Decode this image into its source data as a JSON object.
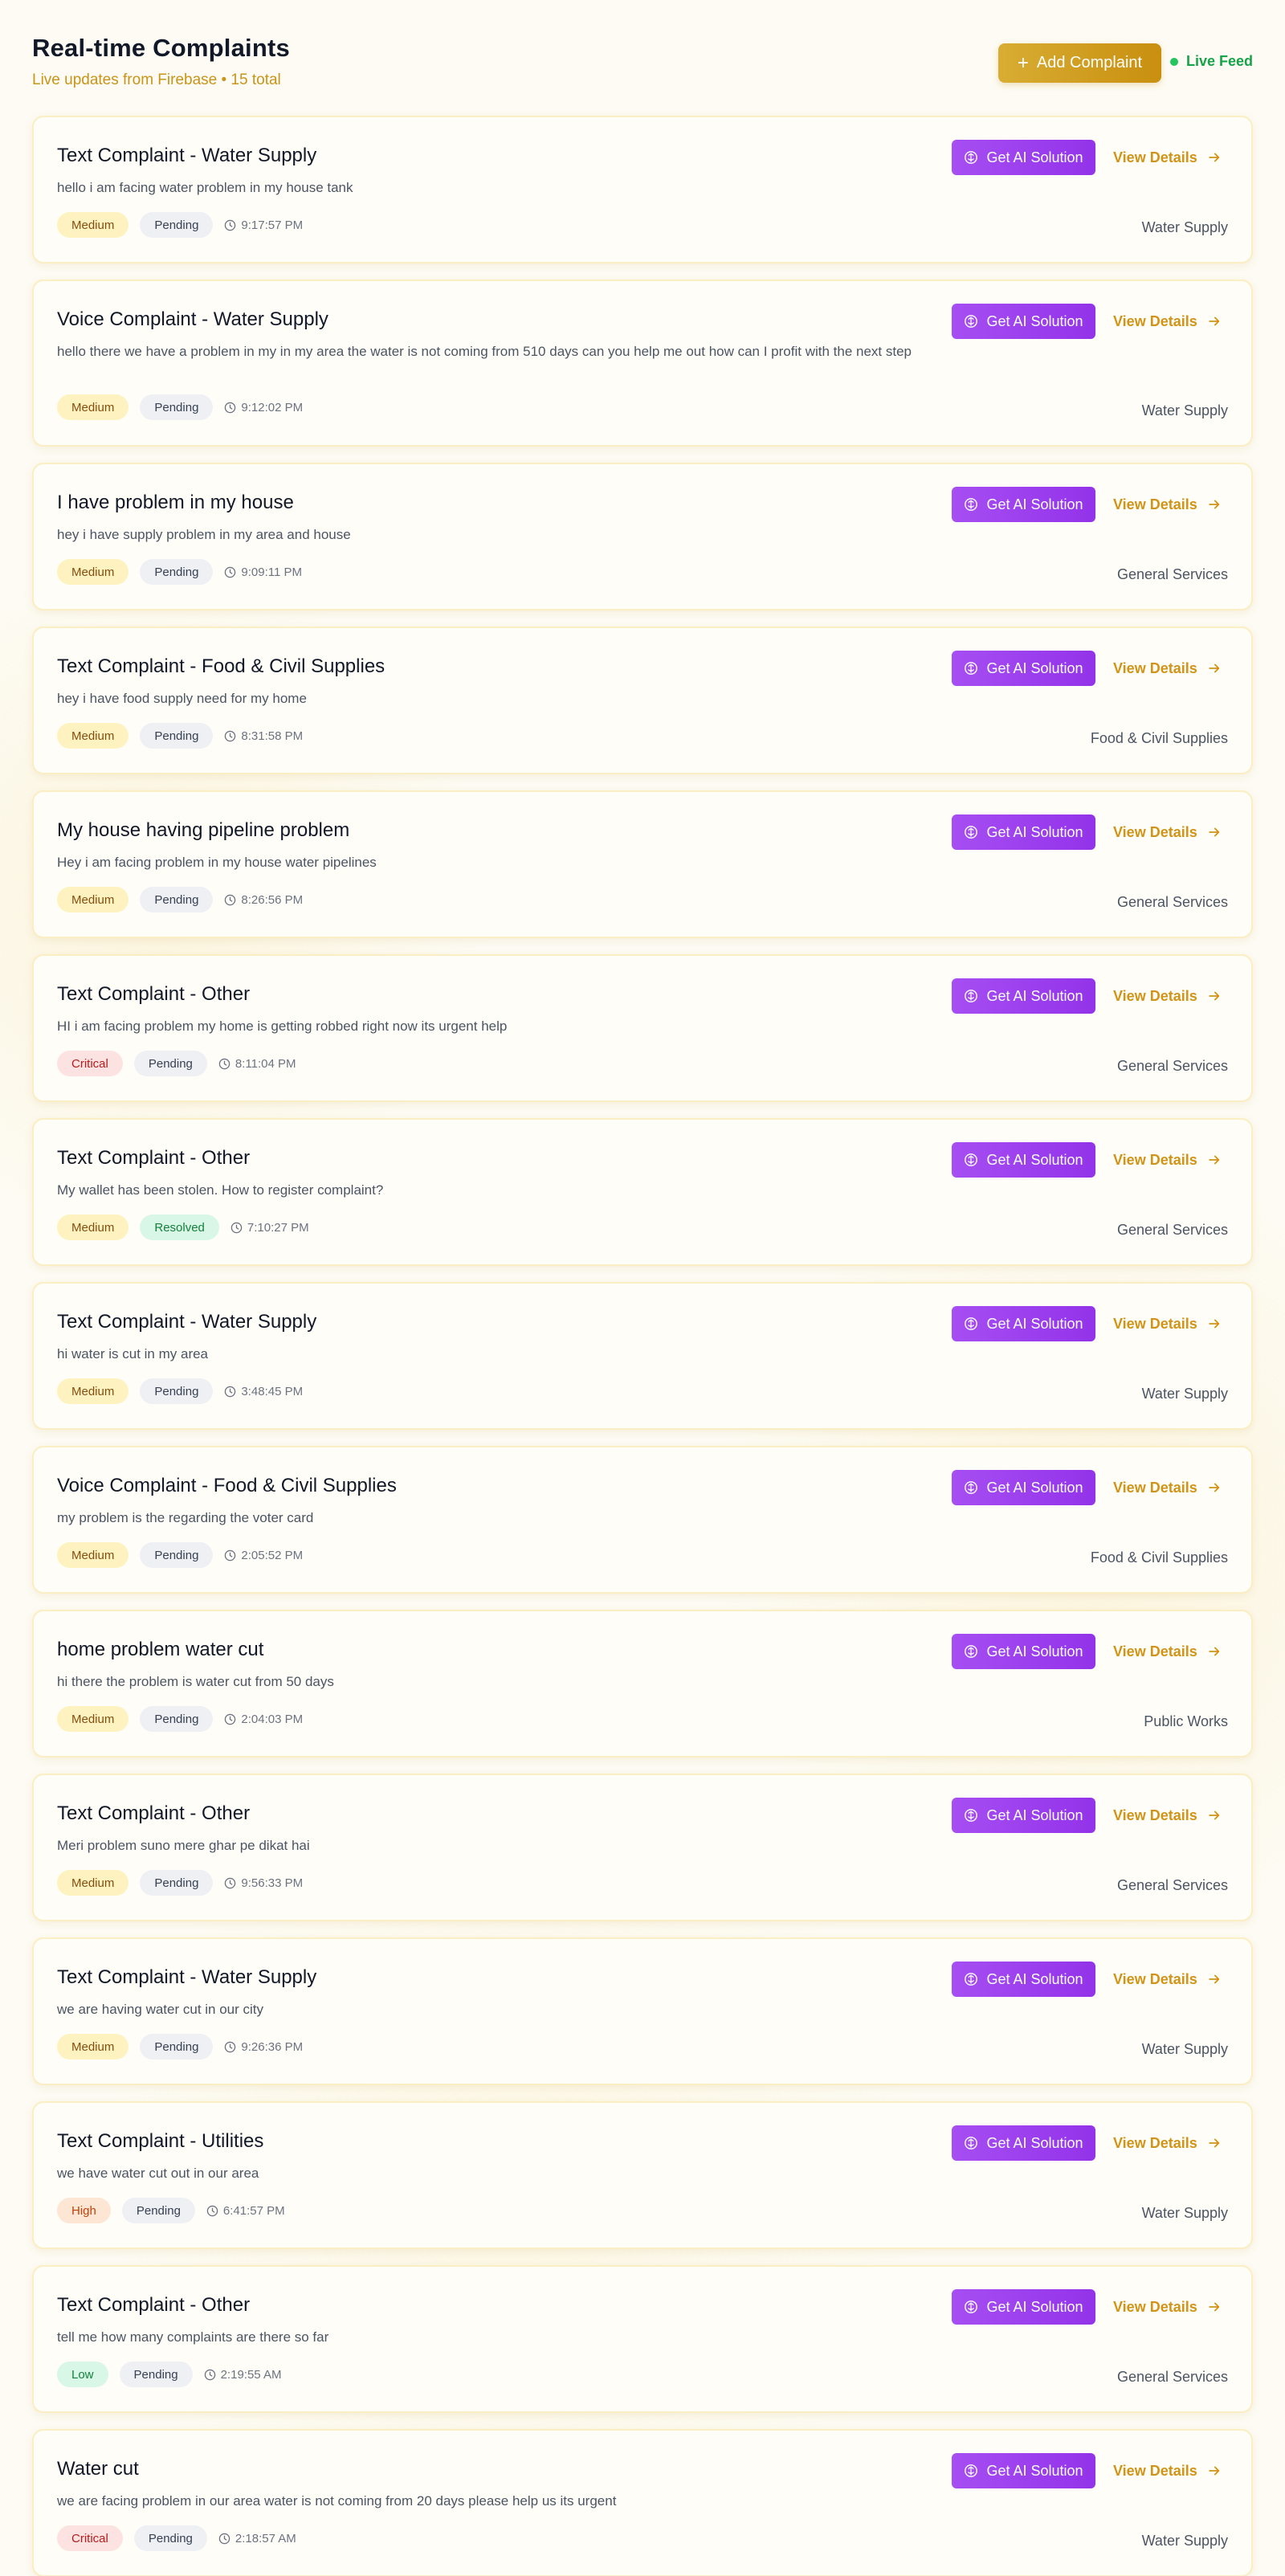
{
  "header": {
    "title": "Real-time Complaints",
    "subtitle": "Live updates from Firebase • 15 total",
    "add_button": "Add Complaint",
    "live_feed": "Live Feed"
  },
  "actions": {
    "ai_solution": "Get AI Solution",
    "view_details": "View Details"
  },
  "colors": {
    "accent": "#d19416",
    "ai_button": "#9333ea",
    "live": "#22c55e"
  },
  "complaints": [
    {
      "title": "Text Complaint - Water Supply",
      "description": "hello i am facing water problem in my house tank",
      "priority": "Medium",
      "status": "Pending",
      "time": "9:17:57 PM",
      "category": "Water Supply"
    },
    {
      "title": "Voice Complaint - Water Supply",
      "description": "hello there we have a problem in my in my area the water is not coming from 510 days can you help me out how can I profit with the next step",
      "priority": "Medium",
      "status": "Pending",
      "time": "9:12:02 PM",
      "category": "Water Supply"
    },
    {
      "title": "I have problem in my house",
      "description": "hey i have supply problem in my area and house",
      "priority": "Medium",
      "status": "Pending",
      "time": "9:09:11 PM",
      "category": "General Services"
    },
    {
      "title": "Text Complaint - Food & Civil Supplies",
      "description": "hey i have food supply need for my home",
      "priority": "Medium",
      "status": "Pending",
      "time": "8:31:58 PM",
      "category": "Food & Civil Supplies"
    },
    {
      "title": "My house having pipeline problem",
      "description": "Hey i am facing problem in my house water pipelines",
      "priority": "Medium",
      "status": "Pending",
      "time": "8:26:56 PM",
      "category": "General Services"
    },
    {
      "title": "Text Complaint - Other",
      "description": "HI i am facing problem my home is getting robbed right now its urgent help",
      "priority": "Critical",
      "status": "Pending",
      "time": "8:11:04 PM",
      "category": "General Services"
    },
    {
      "title": "Text Complaint - Other",
      "description": "My wallet has been stolen. How to register complaint?",
      "priority": "Medium",
      "status": "Resolved",
      "time": "7:10:27 PM",
      "category": "General Services"
    },
    {
      "title": "Text Complaint - Water Supply",
      "description": "hi water is cut in my area",
      "priority": "Medium",
      "status": "Pending",
      "time": "3:48:45 PM",
      "category": "Water Supply"
    },
    {
      "title": "Voice Complaint - Food & Civil Supplies",
      "description": "my problem is the regarding the voter card",
      "priority": "Medium",
      "status": "Pending",
      "time": "2:05:52 PM",
      "category": "Food & Civil Supplies"
    },
    {
      "title": "home problem water cut",
      "description": "hi there the problem is water cut from 50 days",
      "priority": "Medium",
      "status": "Pending",
      "time": "2:04:03 PM",
      "category": "Public Works"
    },
    {
      "title": "Text Complaint - Other",
      "description": "Meri problem suno mere ghar pe dikat hai",
      "priority": "Medium",
      "status": "Pending",
      "time": "9:56:33 PM",
      "category": "General Services"
    },
    {
      "title": "Text Complaint - Water Supply",
      "description": "we are having water cut in our city",
      "priority": "Medium",
      "status": "Pending",
      "time": "9:26:36 PM",
      "category": "Water Supply"
    },
    {
      "title": "Text Complaint - Utilities",
      "description": "we have water cut out in our area",
      "priority": "High",
      "status": "Pending",
      "time": "6:41:57 PM",
      "category": "Water Supply"
    },
    {
      "title": "Text Complaint - Other",
      "description": "tell me how many complaints are there so far",
      "priority": "Low",
      "status": "Pending",
      "time": "2:19:55 AM",
      "category": "General Services"
    },
    {
      "title": "Water cut",
      "description": "we are facing problem in our area water is not coming from 20 days please help us its urgent",
      "priority": "Critical",
      "status": "Pending",
      "time": "2:18:57 AM",
      "category": "Water Supply"
    }
  ]
}
